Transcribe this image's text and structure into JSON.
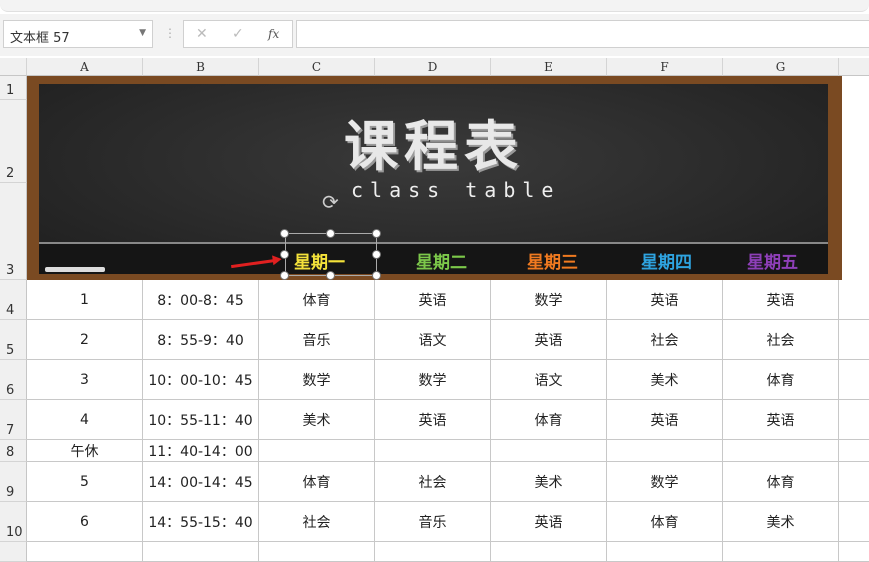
{
  "formula_bar": {
    "name_box": "文本框 57",
    "cancel_icon": "✕",
    "confirm_icon": "✓",
    "fx_label": "fx",
    "value": ""
  },
  "columns": [
    "A",
    "B",
    "C",
    "D",
    "E",
    "F",
    "G"
  ],
  "rows": [
    "1",
    "2",
    "3",
    "4",
    "5",
    "6",
    "7",
    "8",
    "9",
    "10"
  ],
  "banner": {
    "title": "课程表",
    "subtitle": "class table",
    "days": [
      {
        "label": "星期一",
        "color": "#f4e23a"
      },
      {
        "label": "星期二",
        "color": "#7cc84a"
      },
      {
        "label": "星期三",
        "color": "#f07a20"
      },
      {
        "label": "星期四",
        "color": "#2ea3e0"
      },
      {
        "label": "星期五",
        "color": "#8e3fb8"
      }
    ]
  },
  "table": [
    [
      "1",
      "8：00-8：45",
      "体育",
      "英语",
      "数学",
      "英语",
      "英语"
    ],
    [
      "2",
      "8：55-9：40",
      "音乐",
      "语文",
      "英语",
      "社会",
      "社会"
    ],
    [
      "3",
      "10：00-10：45",
      "数学",
      "数学",
      "语文",
      "美术",
      "体育"
    ],
    [
      "4",
      "10：55-11：40",
      "美术",
      "英语",
      "体育",
      "英语",
      "英语"
    ],
    [
      "午休",
      "11：40-14：00",
      "",
      "",
      "",
      "",
      ""
    ],
    [
      "5",
      "14：00-14：45",
      "体育",
      "社会",
      "美术",
      "数学",
      "体育"
    ],
    [
      "6",
      "14：55-15：40",
      "社会",
      "音乐",
      "英语",
      "体育",
      "美术"
    ]
  ]
}
